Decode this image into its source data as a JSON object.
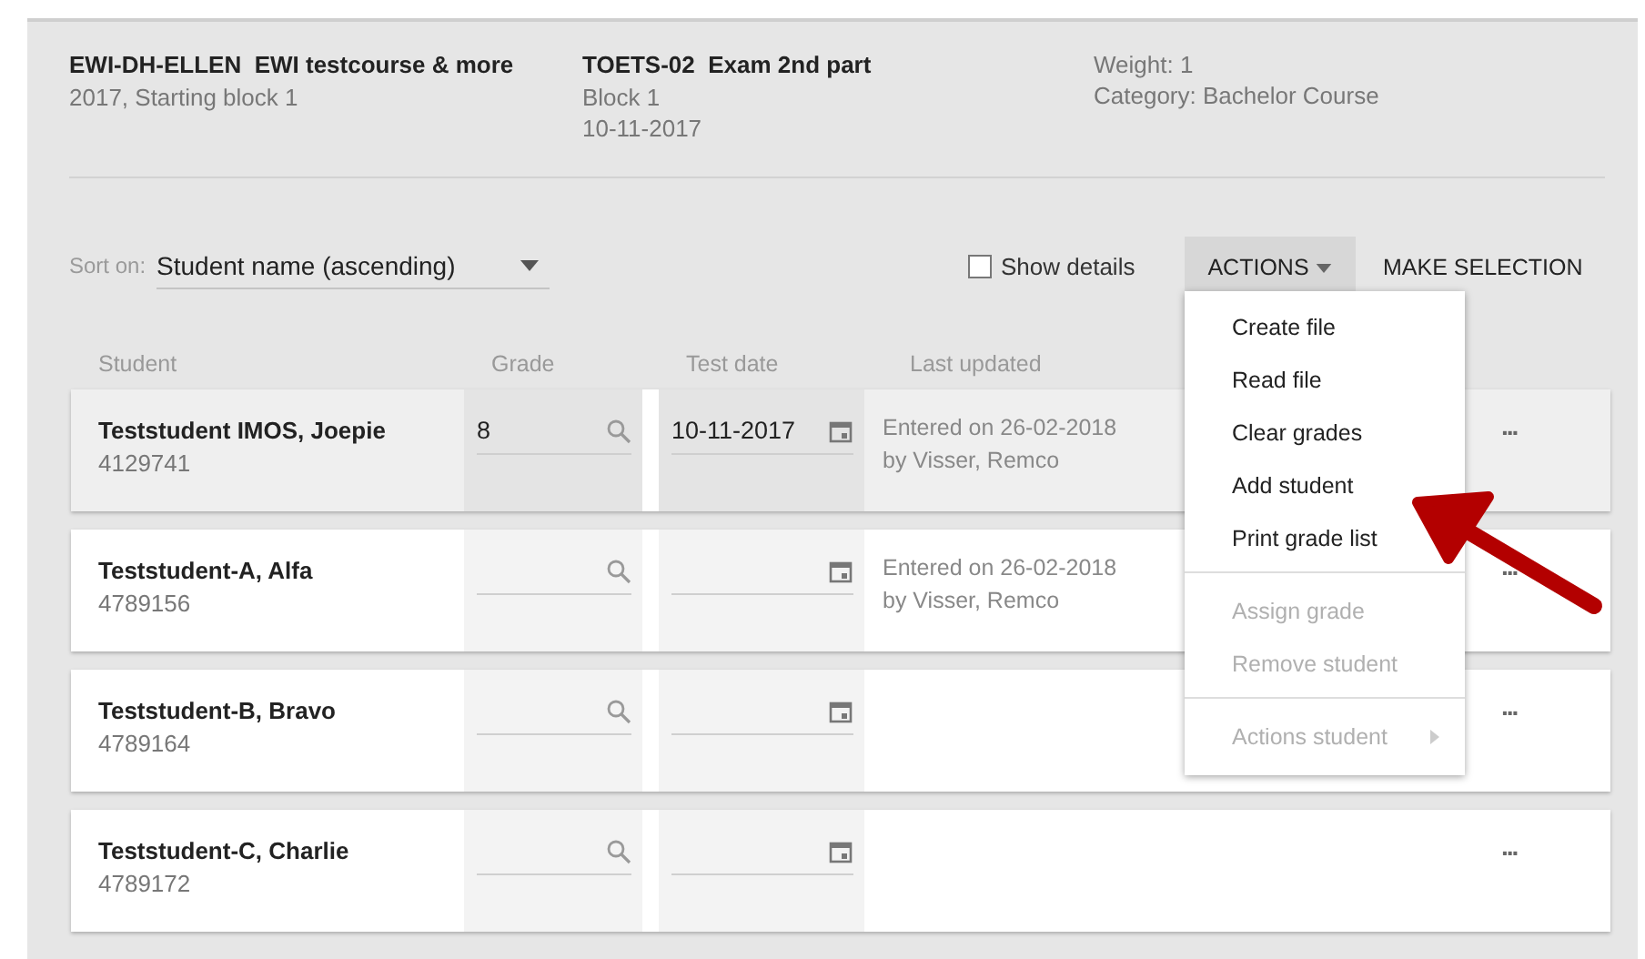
{
  "header": [
    {
      "title": "EWI-DH-ELLEN  EWI testcourse & more",
      "lines": [
        "2017, Starting block 1"
      ]
    },
    {
      "title": "TOETS-02  Exam 2nd part",
      "lines": [
        "Block 1",
        "10-11-2017"
      ]
    },
    {
      "lines": [
        "Weight: 1",
        "Category: Bachelor Course"
      ]
    }
  ],
  "sort": {
    "label": "Sort on:",
    "value": "Student name (ascending)"
  },
  "show_details": {
    "label": "Show details",
    "checked": false
  },
  "actions_button": {
    "label": "ACTIONS",
    "expanded": true
  },
  "make_selection": "MAKE SELECTION",
  "columns": [
    "Student",
    "Grade",
    "Test date",
    "Last updated"
  ],
  "rows": [
    {
      "name": "Teststudent IMOS, Joepie",
      "number": "4129741",
      "grade": "8",
      "test_date": "10-11-2017",
      "updated": [
        "Entered on 26-02-2018",
        "by Visser, Remco"
      ],
      "selected": true,
      "more": "..."
    },
    {
      "name": "Teststudent-A, Alfa",
      "number": "4789156",
      "grade": "",
      "test_date": "",
      "updated": [
        "Entered on 26-02-2018",
        "by Visser, Remco"
      ],
      "selected": false,
      "more": "..."
    },
    {
      "name": "Teststudent-B, Bravo",
      "number": "4789164",
      "grade": "",
      "test_date": "",
      "updated": [],
      "selected": false,
      "more": "..."
    },
    {
      "name": "Teststudent-C, Charlie",
      "number": "4789172",
      "grade": "",
      "test_date": "",
      "updated": [],
      "selected": false,
      "more": "..."
    }
  ],
  "menu": [
    [
      {
        "label": "Create file",
        "disabled": false
      },
      {
        "label": "Read file",
        "disabled": false
      },
      {
        "label": "Clear grades",
        "disabled": false
      },
      {
        "label": "Add student",
        "disabled": false
      },
      {
        "label": "Print grade list",
        "disabled": false
      }
    ],
    [
      {
        "label": "Assign grade",
        "disabled": true
      },
      {
        "label": "Remove student",
        "disabled": true
      }
    ],
    [
      {
        "label": "Actions student",
        "disabled": true,
        "submenu": true
      }
    ]
  ]
}
